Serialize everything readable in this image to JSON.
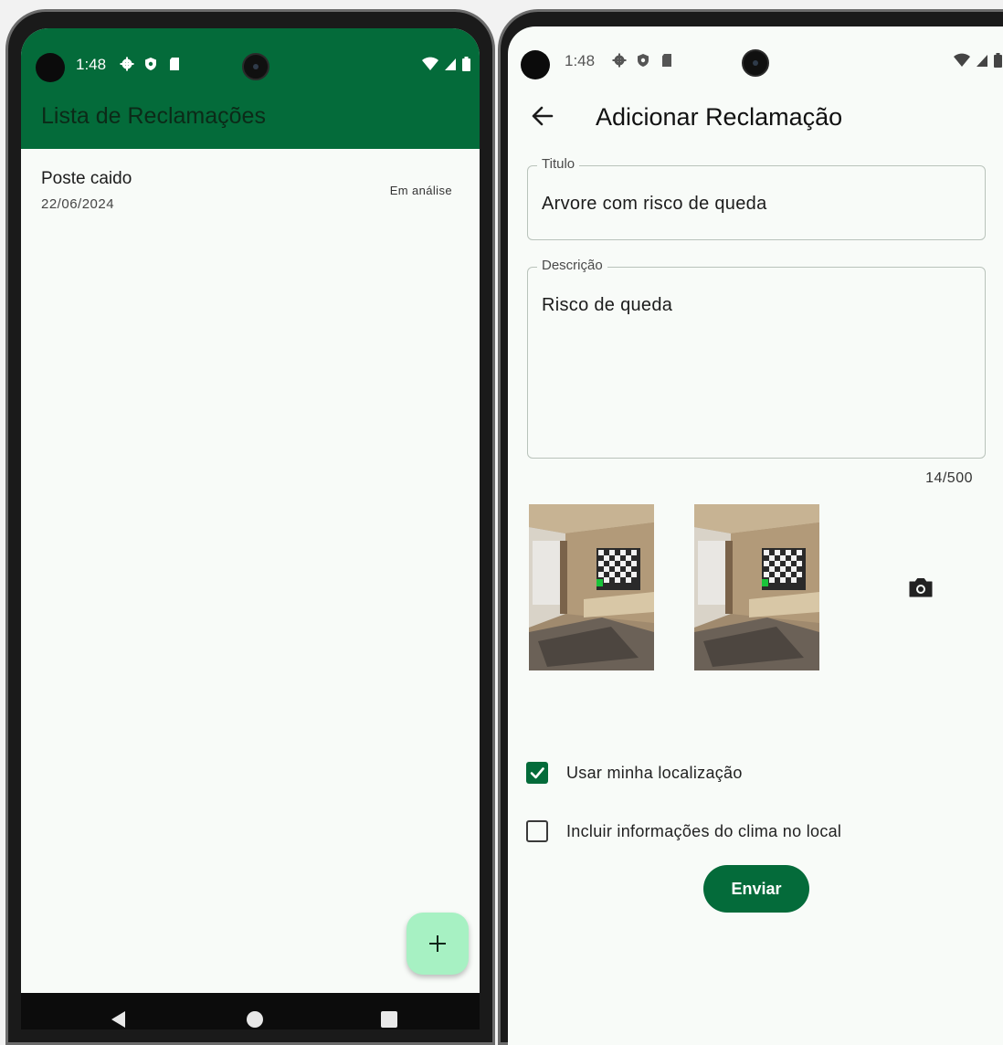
{
  "colors": {
    "primary": "#046b3a",
    "fab": "#a7f1c3",
    "background": "#f8fbf8"
  },
  "list_screen": {
    "status_bar": {
      "time": "1:48",
      "icons": [
        "gear-icon",
        "shield-icon",
        "sd-card-icon",
        "wifi-icon",
        "signal-icon",
        "battery-icon"
      ]
    },
    "app_bar": {
      "title": "Lista de Reclamações"
    },
    "items": [
      {
        "title": "Poste caido",
        "date": "22/06/2024",
        "status": "Em análise"
      }
    ],
    "fab": {
      "icon": "plus-icon",
      "label": "+"
    },
    "nav_bar": {
      "buttons": [
        "back-triangle-icon",
        "home-circle-icon",
        "recents-square-icon"
      ]
    }
  },
  "add_screen": {
    "status_bar": {
      "time": "1:48",
      "icons": [
        "gear-icon",
        "shield-icon",
        "sd-card-icon",
        "wifi-icon",
        "signal-icon",
        "battery-icon"
      ]
    },
    "header": {
      "back_icon": "arrow-left-icon",
      "title": "Adicionar Reclamação"
    },
    "form": {
      "titulo": {
        "label": "Titulo",
        "value": "Arvore com risco de queda"
      },
      "descricao": {
        "label": "Descrição",
        "value": "Risco de queda",
        "counter": "14/500"
      },
      "photos": {
        "count": 2,
        "add_icon": "camera-icon"
      },
      "use_location": {
        "label": "Usar minha localização",
        "checked": true
      },
      "include_weather": {
        "label": "Incluir informações do clima no local",
        "checked": false
      },
      "submit_label": "Enviar"
    }
  }
}
